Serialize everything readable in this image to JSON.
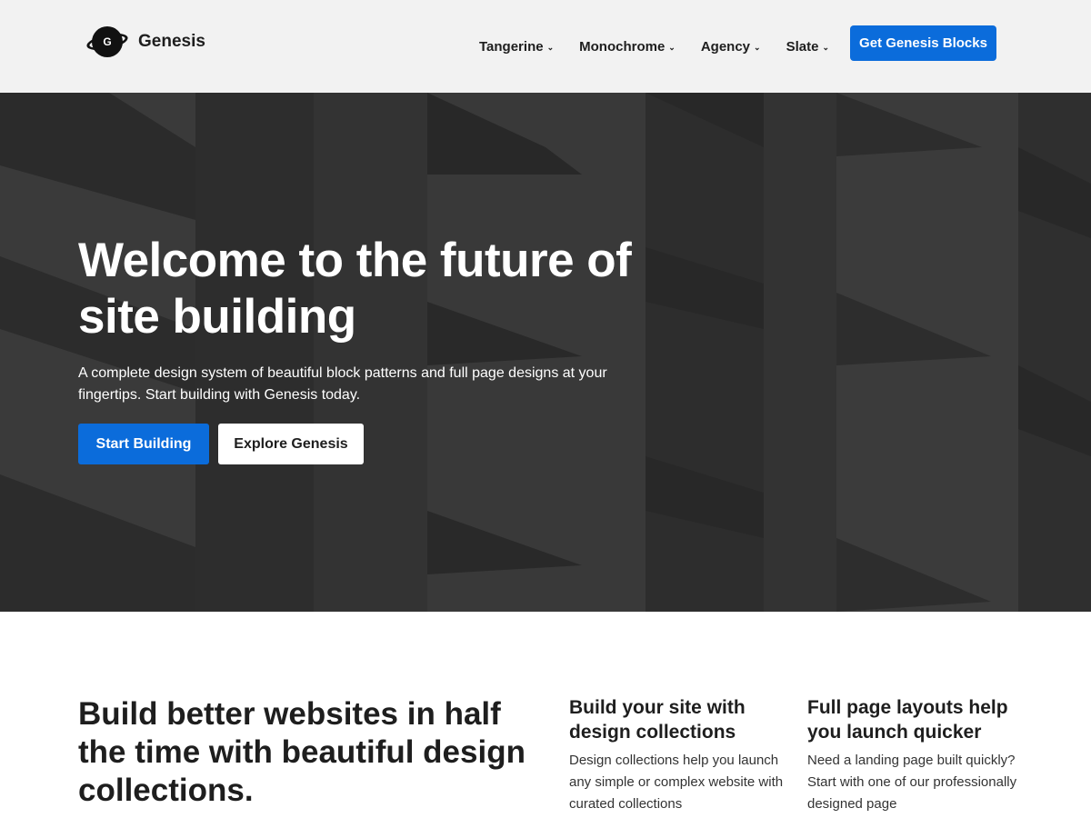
{
  "header": {
    "logo_letter": "G",
    "logo_text": "Genesis",
    "nav": [
      {
        "label": "Tangerine"
      },
      {
        "label": "Monochrome"
      },
      {
        "label": "Agency"
      },
      {
        "label": "Slate"
      }
    ],
    "cta_label": "Get Genesis Blocks"
  },
  "hero": {
    "title": "Welcome to the future of site building",
    "description": "A complete design system of beautiful block patterns and full page designs at your fingertips. Start building with Genesis today.",
    "primary_button": "Start Building",
    "secondary_button": "Explore Genesis"
  },
  "features": {
    "heading": "Build better websites in half the time with beautiful design collections.",
    "columns": [
      {
        "title": "Build your site with design collections",
        "text": "Design collections help you launch any simple or complex website with curated collections"
      },
      {
        "title": "Full page layouts help you launch quicker",
        "text": "Need a landing page built quickly? Start with one of our professionally designed page"
      }
    ]
  },
  "colors": {
    "accent": "#0b6cdb",
    "header_bg": "#f2f2f2",
    "hero_bg": "#3f3f3f"
  },
  "icons": {
    "nav_chevron": "chevron-down-icon",
    "logo": "genesis-planet-logo-icon"
  }
}
